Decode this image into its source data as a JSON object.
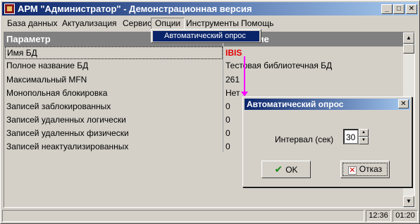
{
  "window": {
    "title": "АРМ \"Администратор\" - Демонстрационная версия",
    "minimize": "_",
    "maximize": "□",
    "close": "✕"
  },
  "menu": {
    "items": [
      "База данных",
      "Актуализация",
      "Сервис",
      "Опции",
      "Инструменты",
      "Помощь"
    ],
    "open_item": "Опции",
    "dropdown": [
      "Автоматический опрос"
    ]
  },
  "grid": {
    "headers": [
      "Параметр",
      "Значение"
    ],
    "rows": [
      {
        "param": "Имя БД",
        "value": "IBIS"
      },
      {
        "param": "Полное название БД",
        "value": "Тестовая библиотечная БД"
      },
      {
        "param": "Максимальный MFN",
        "value": "261"
      },
      {
        "param": "Монопольная блокировка",
        "value": "Нет"
      },
      {
        "param": "Записей заблокированных",
        "value": "0"
      },
      {
        "param": "Записей удаленных логически",
        "value": "0"
      },
      {
        "param": "Записей удаленных физически",
        "value": "0"
      },
      {
        "param": "Записей неактуализированных",
        "value": "0"
      }
    ]
  },
  "status": {
    "time": "12:36",
    "elapsed": "01:20"
  },
  "dialog": {
    "title": "Автоматический опрос",
    "interval_label": "Интервал (сек)",
    "interval_value": "30",
    "ok_label": "OK",
    "cancel_label": "Отказ"
  },
  "colors": {
    "accent": "#0a246a",
    "highlight_value": "#e00000",
    "arrow": "#ff00ff"
  }
}
